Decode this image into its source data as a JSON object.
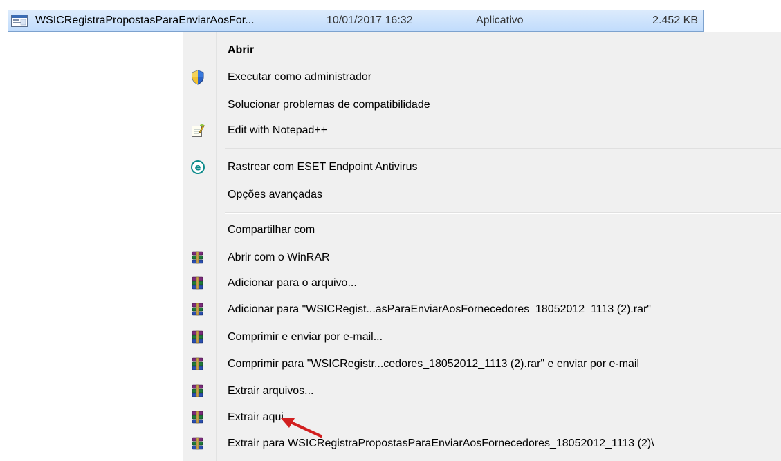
{
  "file": {
    "name": "WSICRegistraPropostasParaEnviarAosFor...",
    "date": "10/01/2017 16:32",
    "type": "Aplicativo",
    "size": "2.452 KB",
    "icon": "application-window-icon"
  },
  "menu": {
    "items": [
      {
        "label": "Abrir",
        "icon": ""
      },
      {
        "label": "Executar como administrador",
        "icon": "uac-shield-icon"
      },
      {
        "label": "Solucionar problemas de compatibilidade",
        "icon": ""
      },
      {
        "label": "Edit with Notepad++",
        "icon": "notepad-plus-plus-icon"
      },
      {
        "label": "Rastrear com ESET Endpoint Antivirus",
        "icon": "eset-icon"
      },
      {
        "label": "Opções avançadas",
        "icon": ""
      },
      {
        "label": "Compartilhar com",
        "icon": ""
      },
      {
        "label": "Abrir com o WinRAR",
        "icon": "winrar-icon"
      },
      {
        "label": "Adicionar para o arquivo...",
        "icon": "winrar-icon"
      },
      {
        "label": "Adicionar para \"WSICRegist...asParaEnviarAosFornecedores_18052012_1113 (2).rar\"",
        "icon": "winrar-icon"
      },
      {
        "label": "Comprimir e enviar por e-mail...",
        "icon": "winrar-icon"
      },
      {
        "label": "Comprimir para \"WSICRegistr...cedores_18052012_1113 (2).rar\" e enviar por e-mail",
        "icon": "winrar-icon"
      },
      {
        "label": "Extrair arquivos...",
        "icon": "winrar-icon"
      },
      {
        "label": "Extrair aqui",
        "icon": "winrar-icon"
      },
      {
        "label": "Extrair para WSICRegistraPropostasParaEnviarAosFornecedores_18052012_1113 (2)\\",
        "icon": "winrar-icon"
      }
    ]
  },
  "colors": {
    "selection": "#cce4fb",
    "menu_background": "#f0f0f0",
    "arrow": "#d21f1f"
  }
}
